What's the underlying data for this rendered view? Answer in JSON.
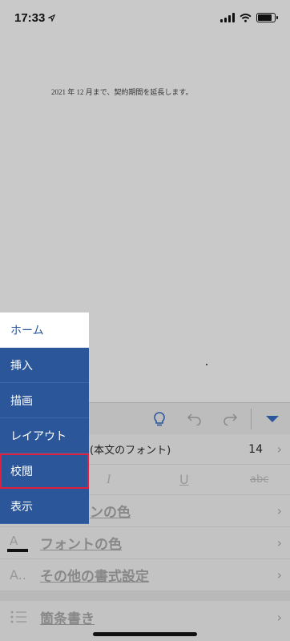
{
  "status_bar": {
    "time": "17:33",
    "location_icon": "location-arrow-icon"
  },
  "document": {
    "text": "2021 年 12 月まで、契約期間を延長します。"
  },
  "toolbar": {
    "icons": [
      "lightbulb-icon",
      "undo-icon",
      "redo-icon",
      "collapse-ribbon-icon"
    ]
  },
  "ribbon": {
    "font_name": "(本文のフォント)",
    "font_size": "14",
    "format_buttons": {
      "italic": "I",
      "underline": "U",
      "strikethrough": "abc"
    },
    "items": [
      {
        "label": "ンの色"
      },
      {
        "label": "フォントの色",
        "icon": "A"
      },
      {
        "label": "その他の書式設定",
        "icon": "A.."
      },
      {
        "label": "箇条書き"
      }
    ]
  },
  "tabs": [
    {
      "label": "ホーム",
      "active": true
    },
    {
      "label": "挿入"
    },
    {
      "label": "描画"
    },
    {
      "label": "レイアウト"
    },
    {
      "label": "校閲",
      "highlighted": true
    },
    {
      "label": "表示"
    }
  ],
  "colors": {
    "accent": "#2b579a",
    "highlight": "#e0203a"
  }
}
